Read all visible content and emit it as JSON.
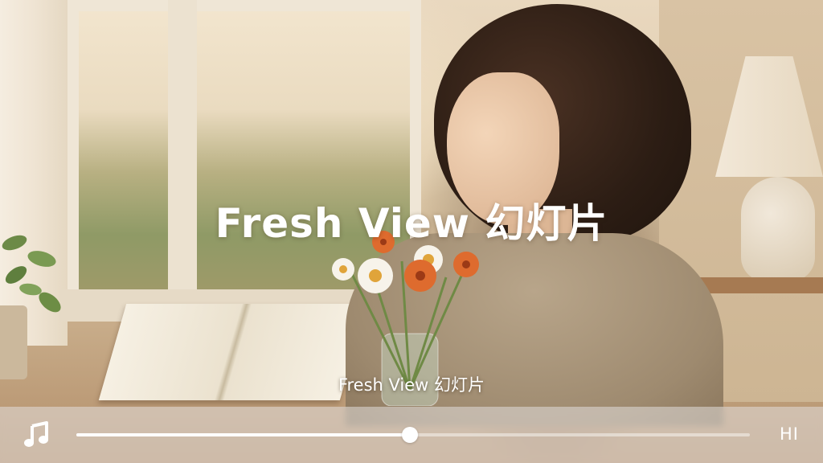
{
  "slide": {
    "title": "Fresh View 幻灯片",
    "caption": "Fresh View 幻灯片",
    "background_image": "woman-with-flowers-by-window"
  },
  "player": {
    "icon": "music-note-icon",
    "progress": 0.495,
    "right_label": "HI"
  },
  "colors": {
    "text": "#ffffff",
    "bar_background": "rgba(225,222,220,0.55)",
    "track": "rgba(255,255,255,0.45)",
    "fill": "#ffffff"
  }
}
